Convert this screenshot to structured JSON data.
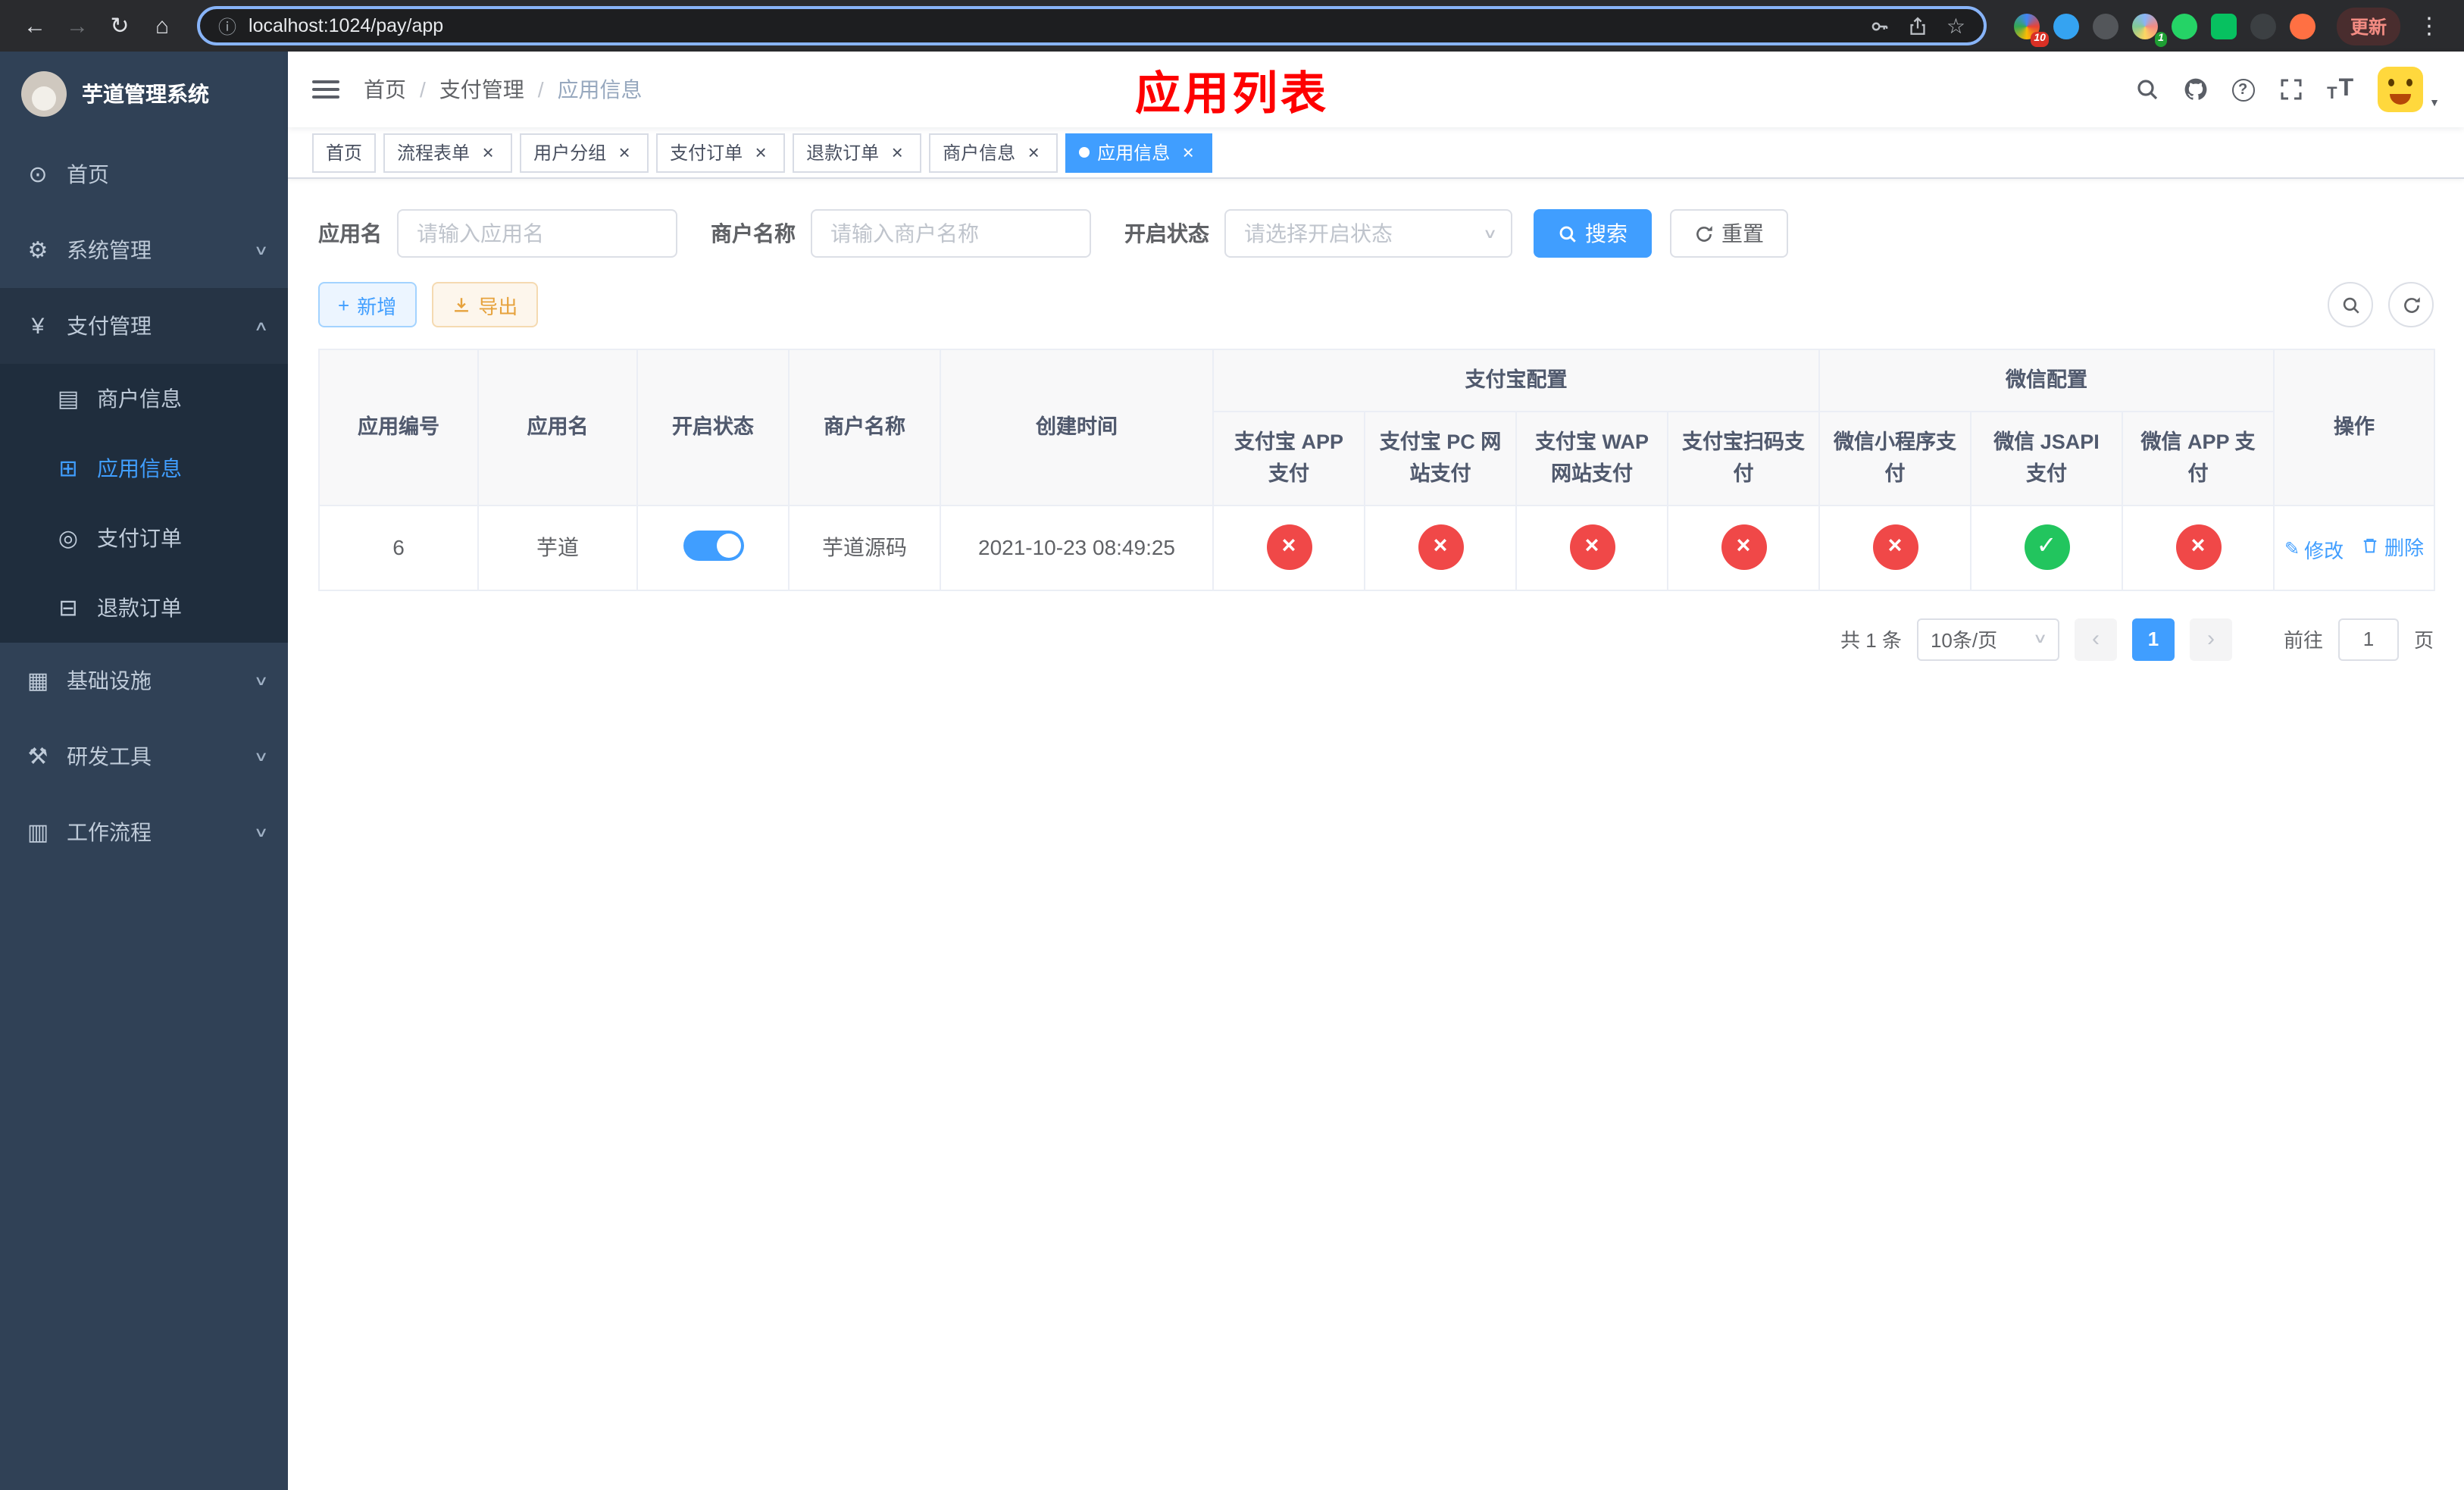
{
  "browser": {
    "url": "localhost:1024/pay/app",
    "update_button": "更新",
    "ext_badge_puzzle": "10",
    "ext_badge_green": "1"
  },
  "app": {
    "logo_title": "芋道管理系统"
  },
  "sidebar": {
    "home": "首页",
    "system": "系统管理",
    "payment": "支付管理",
    "payment_children": [
      "商户信息",
      "应用信息",
      "支付订单",
      "退款订单"
    ],
    "infra": "基础设施",
    "devtools": "研发工具",
    "workflow": "工作流程"
  },
  "breadcrumb": {
    "items": [
      "首页",
      "支付管理",
      "应用信息"
    ],
    "separator": "/"
  },
  "header": {
    "page_title": "应用列表"
  },
  "tabs": [
    {
      "label": "首页",
      "closable": false,
      "active": false
    },
    {
      "label": "流程表单",
      "closable": true,
      "active": false
    },
    {
      "label": "用户分组",
      "closable": true,
      "active": false
    },
    {
      "label": "支付订单",
      "closable": true,
      "active": false
    },
    {
      "label": "退款订单",
      "closable": true,
      "active": false
    },
    {
      "label": "商户信息",
      "closable": true,
      "active": false
    },
    {
      "label": "应用信息",
      "closable": true,
      "active": true
    }
  ],
  "filters": {
    "app_name_label": "应用名",
    "app_name_placeholder": "请输入应用名",
    "merchant_name_label": "商户名称",
    "merchant_name_placeholder": "请输入商户名称",
    "status_label": "开启状态",
    "status_placeholder": "请选择开启状态",
    "search_label": "搜索",
    "reset_label": "重置"
  },
  "toolbar": {
    "add_label": "新增",
    "export_label": "导出"
  },
  "table": {
    "col_headers": [
      "应用编号",
      "应用名",
      "开启状态",
      "商户名称",
      "创建时间"
    ],
    "group_headers": [
      "支付宝配置",
      "微信配置"
    ],
    "sub_headers": [
      "支付宝 APP 支付",
      "支付宝 PC 网站支付",
      "支付宝 WAP 网站支付",
      "支付宝扫码支付",
      "微信小程序支付",
      "微信 JSAPI 支付",
      "微信 APP 支付"
    ],
    "action_header": "操作",
    "rows": [
      {
        "app_id": "6",
        "app_name": "芋道",
        "enabled": true,
        "merchant_name": "芋道源码",
        "create_time": "2021-10-23 08:49:25",
        "statuses": [
          "fail",
          "fail",
          "fail",
          "fail",
          "fail",
          "success",
          "fail"
        ],
        "edit_label": "修改",
        "delete_label": "删除"
      }
    ]
  },
  "pagination": {
    "total_text": "共 1 条",
    "page_size_text": "10条/页",
    "current_page": "1",
    "goto_prefix": "前往",
    "goto_value": "1",
    "goto_suffix": "页"
  },
  "colors": {
    "primary": "#409eff",
    "success": "#22c55e",
    "danger": "#f04848",
    "warning": "#e6a23c",
    "sidebar_bg": "#304156",
    "sidebar_sub_bg": "#1f2d3d",
    "title_red": "#fe0000"
  },
  "icons": {
    "back": "←",
    "forward": "→",
    "reload": "↻",
    "home": "⌂",
    "info": "ⓘ",
    "star": "☆",
    "menu_dots": "⋮",
    "question": "?",
    "font_size": "T",
    "chevron_down": "∨",
    "chevron_up": "∧",
    "caret_down": "▼",
    "dashboard": "⊙",
    "gear": "⚙",
    "yen": "¥",
    "merchant": "▤",
    "app_grid": "⊞",
    "order": "◎",
    "refund": "⊟",
    "infra": "▦",
    "tools": "⚒",
    "workflow": "▥",
    "plus": "+",
    "close": "×",
    "check": "✓",
    "cross": "×",
    "edit": "✎",
    "prev": "‹",
    "next": "›"
  }
}
